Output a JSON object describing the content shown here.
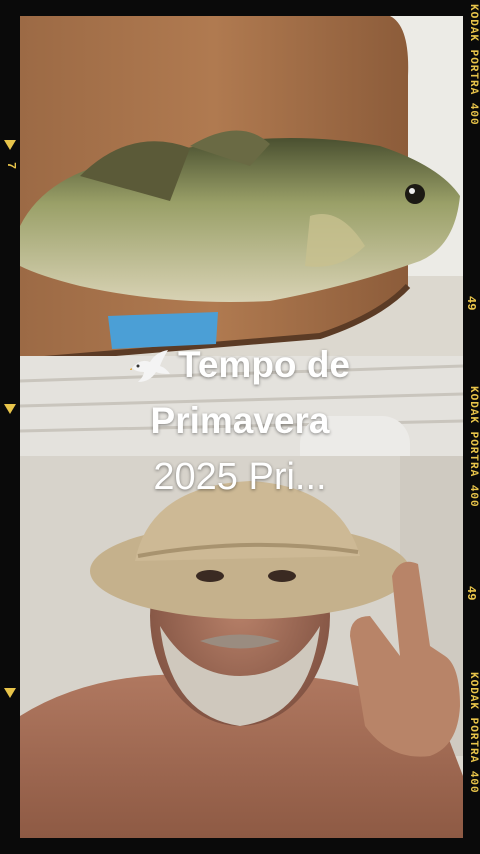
{
  "caption": {
    "line1": "Tempo de",
    "line2": "Primavera",
    "line3": "2025 Pri..."
  },
  "film": {
    "brand_top": "KODAK PORTRA 400",
    "brand_mid": "KODAK PORTRA 400",
    "brand_bottom": "KODAK PORTRA 400",
    "frame_num_a": "49",
    "frame_num_b": "49",
    "frame_num_left": "7",
    "accent": "#e8c44a"
  },
  "icons": {
    "dove": "dove-icon"
  }
}
